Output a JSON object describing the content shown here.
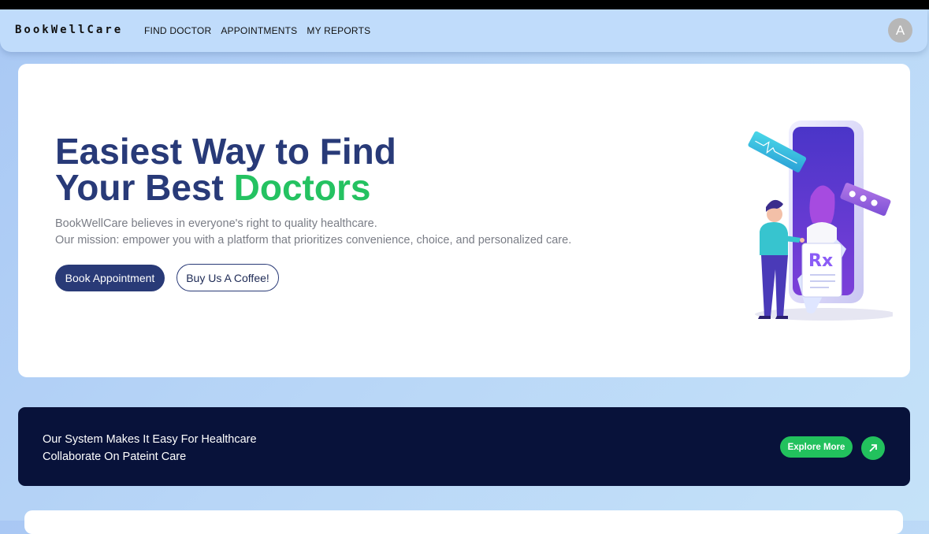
{
  "navbar": {
    "brand": "BookWellCare",
    "links": [
      "FIND DOCTOR",
      "APPOINTMENTS",
      "MY REPORTS"
    ],
    "avatar_letter": "A"
  },
  "hero": {
    "title_line1": "Easiest Way to Find",
    "title_line2_prefix": "Your Best ",
    "title_line2_accent": "Doctors",
    "description_line1": "BookWellCare believes in everyone's right to quality healthcare.",
    "description_line2": "Our mission: empower you with a platform that prioritizes convenience, choice, and personalized care.",
    "primary_button": "Book Appointment",
    "secondary_button": "Buy Us A Coffee!",
    "illustration_text": "Rx"
  },
  "banner": {
    "line1": "Our System Makes It Easy For Healthcare",
    "line2": "Collaborate On Pateint Care",
    "explore_button": "Explore More"
  },
  "colors": {
    "navy": "#283a78",
    "accent_green": "#24c261",
    "banner_bg": "#08123a",
    "navbar_bg": "#c0dcfb"
  }
}
